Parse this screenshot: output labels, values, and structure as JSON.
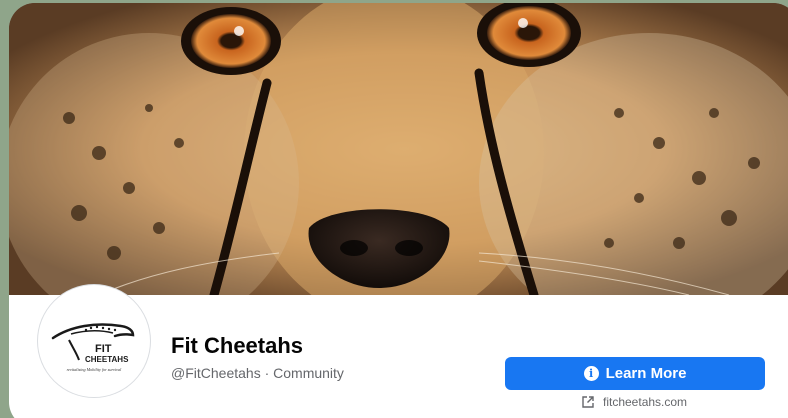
{
  "page": {
    "name": "Fit Cheetahs",
    "handle_category": "@FitCheetahs · Community"
  },
  "cover": {
    "description_icon": "cheetah-face-photo"
  },
  "avatar": {
    "logo_line1": "FIT",
    "logo_line2": "CHEETAHS",
    "logo_tagline": "revitalising Mobility for survival"
  },
  "actions": {
    "learn_more_label": "Learn More",
    "learn_more_icon": "info-icon",
    "website_label": "fitcheetahs.com",
    "website_icon": "external-link-icon"
  },
  "colors": {
    "accent": "#1877f2",
    "background": "#8fa58a",
    "text_primary": "#050505",
    "text_secondary": "#65676b"
  }
}
